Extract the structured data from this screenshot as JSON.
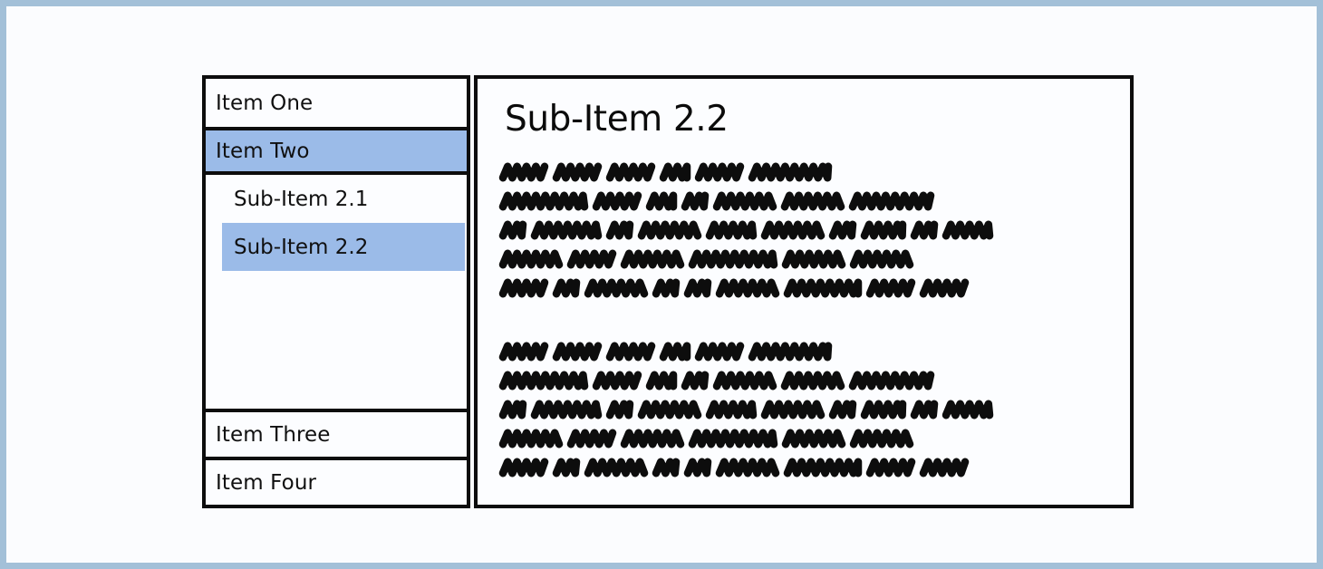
{
  "page": {
    "background_color": "#fbfcfe",
    "border_color": "#a3c0d8"
  },
  "theme": {
    "ink_color": "#0d0d0d",
    "highlight_color": "#9bbbe8",
    "panel_background": "#fcfdff",
    "text_color": "#101010"
  },
  "sidebar": {
    "name": "navigation-sidebar",
    "items": [
      {
        "label": "Item One",
        "level": 1,
        "selected": false
      },
      {
        "label": "Item Two",
        "level": 1,
        "selected": true
      },
      {
        "label": "Sub-Item 2.1",
        "level": 2,
        "selected": false
      },
      {
        "label": "Sub-Item 2.2",
        "level": 2,
        "selected": true
      },
      {
        "label": "Item Three",
        "level": 1,
        "selected": false
      },
      {
        "label": "Item Four",
        "level": 1,
        "selected": false
      }
    ]
  },
  "content": {
    "title": "Sub-Item 2.2",
    "body_style": "scribble-placeholder-text",
    "paragraphs": [
      {
        "lines": [
          [
            46,
            46,
            46,
            26,
            46,
            84
          ],
          [
            90,
            46,
            26,
            22,
            62,
            62,
            86
          ],
          [
            22,
            70,
            22,
            62,
            48,
            62,
            22,
            42,
            22,
            48
          ],
          [
            62,
            46,
            62,
            90,
            62,
            62
          ],
          [
            46,
            22,
            62,
            22,
            22,
            62,
            78,
            46,
            46
          ]
        ]
      },
      {
        "lines": [
          [
            46,
            46,
            46,
            26,
            46,
            84
          ],
          [
            90,
            46,
            26,
            22,
            62,
            62,
            86
          ],
          [
            22,
            70,
            22,
            62,
            48,
            62,
            22,
            42,
            22,
            48
          ],
          [
            62,
            46,
            62,
            90,
            62,
            62
          ],
          [
            46,
            22,
            62,
            22,
            22,
            62,
            78,
            46,
            46
          ]
        ]
      }
    ]
  }
}
